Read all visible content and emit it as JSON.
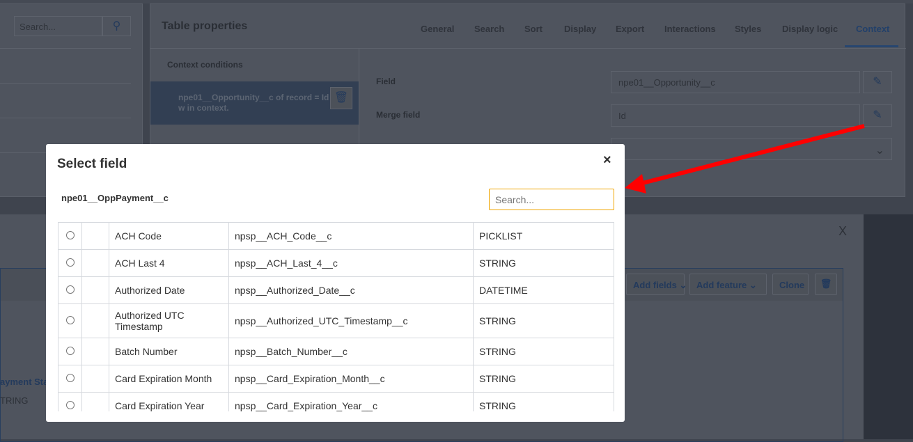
{
  "left_panel": {
    "search_placeholder": "Search...",
    "search_icon": "search-icon"
  },
  "table_properties": {
    "title": "Table properties",
    "tabs": [
      "General",
      "Search",
      "Sort",
      "Display",
      "Export",
      "Interactions",
      "Styles",
      "Display logic",
      "Context"
    ],
    "active_tab": "Context",
    "context_conditions_label": "Context conditions",
    "condition_text": "npe01__Opportunity__c of record = Id w in context.",
    "field_label": "Field",
    "field_value": "npe01__Opportunity__c",
    "merge_field_label": "Merge field",
    "merge_field_value": "Id"
  },
  "background_editor": {
    "close": "X",
    "buttons": [
      "Add fields",
      "Add feature",
      "Clone"
    ],
    "column_label": "ayment Sta",
    "column_type": "TRING"
  },
  "modal": {
    "title": "Select field",
    "close": "×",
    "object_name": "npe01__OppPayment__c",
    "search_placeholder": "Search...",
    "rows": [
      {
        "label": "ACH Code",
        "api": "npsp__ACH_Code__c",
        "type": "PICKLIST"
      },
      {
        "label": "ACH Last 4",
        "api": "npsp__ACH_Last_4__c",
        "type": "STRING"
      },
      {
        "label": "Authorized Date",
        "api": "npsp__Authorized_Date__c",
        "type": "DATETIME"
      },
      {
        "label": "Authorized UTC Timestamp",
        "api": "npsp__Authorized_UTC_Timestamp__c",
        "type": "STRING"
      },
      {
        "label": "Batch Number",
        "api": "npsp__Batch_Number__c",
        "type": "STRING"
      },
      {
        "label": "Card Expiration Month",
        "api": "npsp__Card_Expiration_Month__c",
        "type": "STRING"
      },
      {
        "label": "Card Expiration Year",
        "api": "npsp__Card_Expiration_Year__c",
        "type": "STRING"
      }
    ]
  },
  "colors": {
    "accent": "#2b5c9a",
    "search_focus": "#f0a500",
    "annotation_arrow": "#ff0000"
  }
}
